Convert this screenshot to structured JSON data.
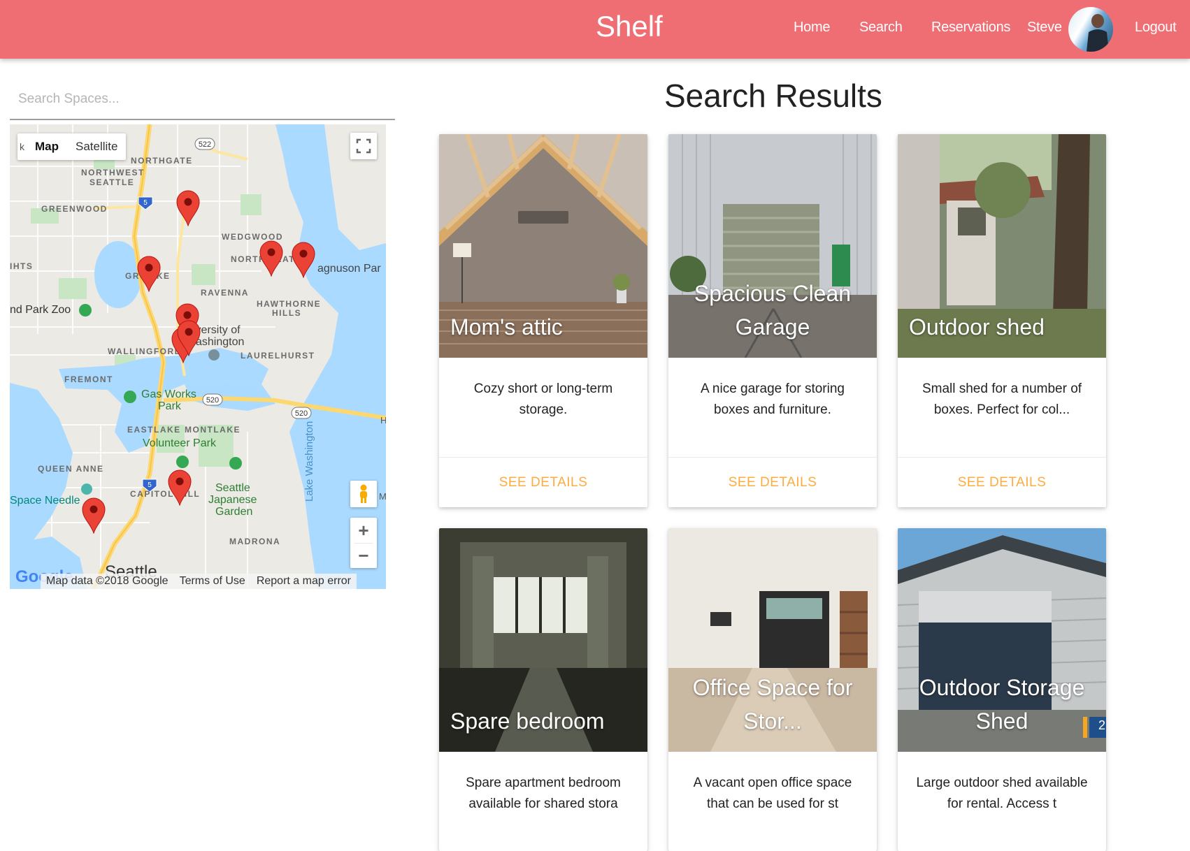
{
  "header": {
    "brand": "Shelf",
    "nav": [
      "Home",
      "Search",
      "Reservations"
    ],
    "user_name": "Steve",
    "logout": "Logout"
  },
  "search": {
    "placeholder": "Search Spaces..."
  },
  "map": {
    "type_buttons": [
      "Map",
      "Satellite"
    ],
    "labels": {
      "northgate": "NORTHGATE",
      "northwest_seattle_1": "NORTHWEST",
      "northwest_seattle_2": "SEATTLE",
      "greenwood": "GREENWOOD",
      "wedgwood": "WEDGWOOD",
      "north_seattle": "NORTH SEAT",
      "magnuson": "agnuson Par",
      "green_lake": "GR     LAKE",
      "heights": "IHTS",
      "ravenna": "RAVENNA",
      "hawthorne_1": "HAWTHORNE",
      "hawthorne_2": "HILLS",
      "zoo": "nd Park Zoo",
      "uw_1": "iversity of",
      "uw_2": "ashington",
      "wallingford": "WALLINGFORD",
      "laurelhurst": "LAURELHURST",
      "fremont": "FREMONT",
      "gas_works_1": "Gas Works",
      "gas_works_2": "Park",
      "eastlake": "EASTLAKE",
      "montlake": "MONTLAKE",
      "volunteer_park": "Volunteer Park",
      "queen_anne": "QUEEN ANNE",
      "lake_washington": "Lake Washington",
      "space_needle": "Space Needle",
      "capitol_hill": "CAPITOL HILL",
      "japanese_garden_1": "Seattle",
      "japanese_garden_2": "Japanese",
      "japanese_garden_3": "Garden",
      "madrona": "MADRONA",
      "seattle": "Seattle",
      "google": "Google",
      "edge_h": "H",
      "edge_m": "M",
      "edge_k": "k",
      "route_522": "522",
      "route_520a": "520",
      "route_520b": "520",
      "i5_a": "5",
      "i5_b": "5"
    },
    "footer": [
      "Map data ©2018 Google",
      "Terms of Use",
      "Report a map error"
    ],
    "markers": 9,
    "zoom_in": "+",
    "zoom_out": "−"
  },
  "results": {
    "title": "Search Results",
    "cards": [
      {
        "title": "Mom's attic",
        "description": "Cozy short or long-term storage.",
        "action": "SEE DETAILS"
      },
      {
        "title": "Spacious Clean Garage",
        "description": "A nice garage for storing boxes and furniture.",
        "action": "SEE DETAILS"
      },
      {
        "title": "Outdoor shed",
        "description": "Small shed for a number of boxes. Perfect for col...",
        "action": "SEE DETAILS"
      },
      {
        "title": "Spare bedroom",
        "description": "Spare apartment bedroom available for shared stora",
        "action": "SEE DETAILS"
      },
      {
        "title": "Office Space for Stor...",
        "description": "A vacant open office space that can be used for st",
        "action": "SEE DETAILS"
      },
      {
        "title": "Outdoor Storage Shed",
        "description": "Large outdoor shed available for rental. Access t",
        "action": "SEE DETAILS"
      }
    ],
    "badge_number": "2"
  },
  "colors": {
    "header": "#ee6e73",
    "action": "#ffab40",
    "marker": "#ea4335",
    "water": "#aadaff",
    "park": "#c5e8c5",
    "highway": "#fdd870"
  }
}
